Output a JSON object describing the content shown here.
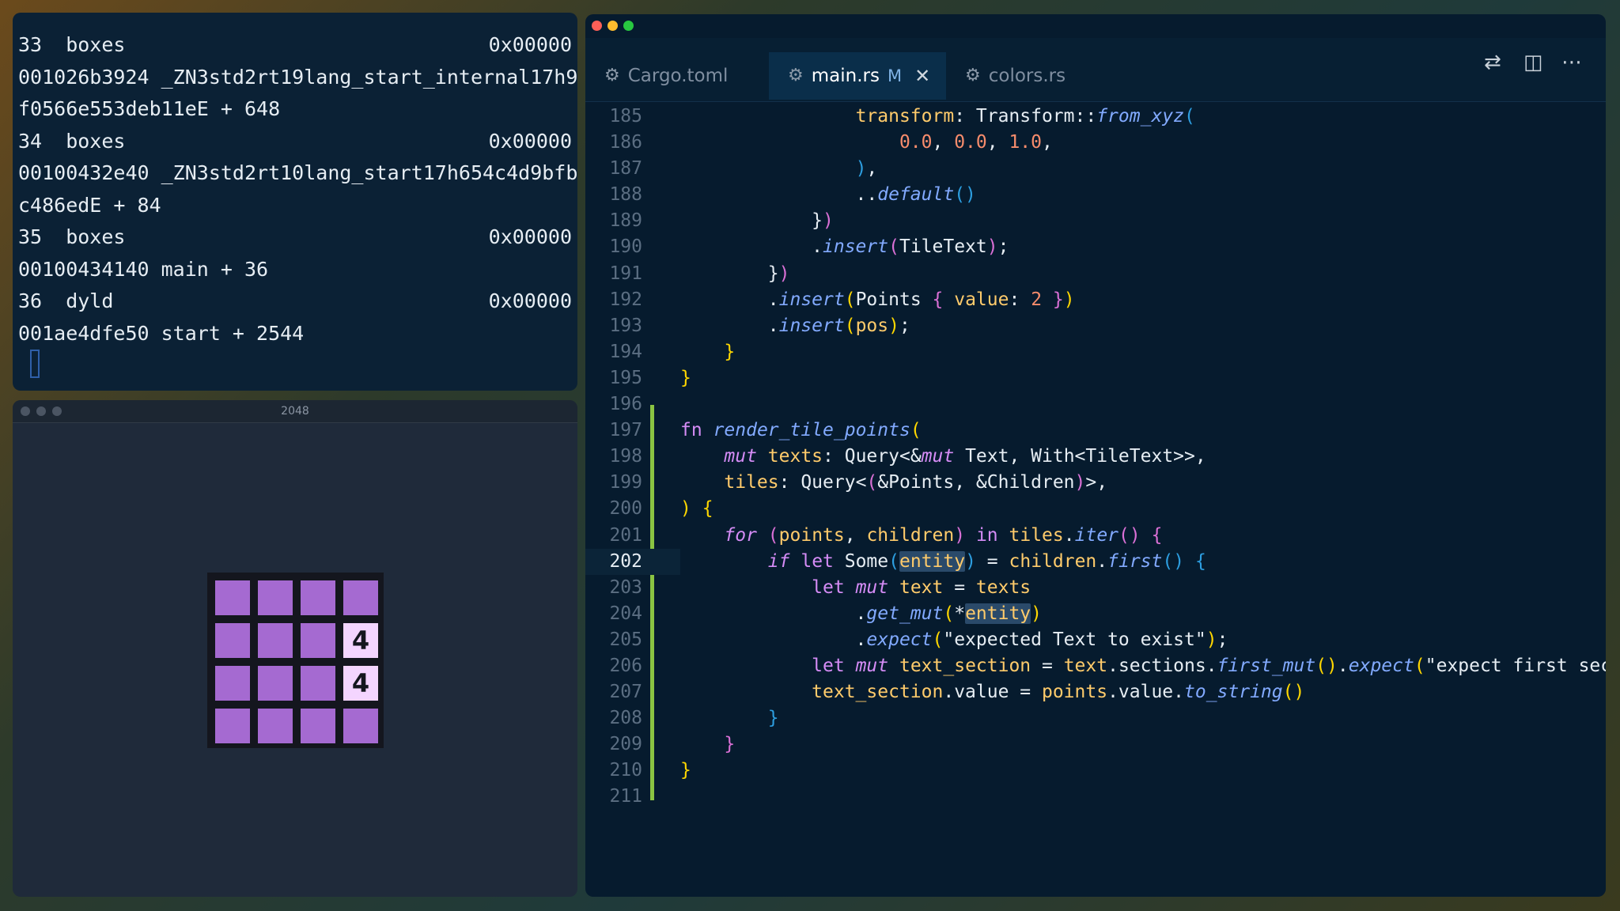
{
  "terminal": {
    "lines": [
      {
        "left": "33  boxes",
        "right": "0x00000"
      },
      {
        "left": "001026b3924 _ZN3std2rt19lang_start_internal17h9",
        "right": ""
      },
      {
        "left": "f0566e553deb11eE + 648",
        "right": ""
      },
      {
        "left": "34  boxes",
        "right": "0x00000"
      },
      {
        "left": "00100432e40 _ZN3std2rt10lang_start17h654c4d9bfb",
        "right": ""
      },
      {
        "left": "c486edE + 84",
        "right": ""
      },
      {
        "left": "35  boxes",
        "right": "0x00000"
      },
      {
        "left": "00100434140 main + 36",
        "right": ""
      },
      {
        "left": "36  dyld",
        "right": "0x00000"
      },
      {
        "left": "001ae4dfe50 start + 2544",
        "right": ""
      }
    ]
  },
  "game": {
    "window_title": "2048",
    "tile_color": "#a56ad1",
    "tile_highlight_color": "#f4d5ff",
    "grid": [
      [
        "",
        "",
        "",
        ""
      ],
      [
        "",
        "",
        "",
        "4"
      ],
      [
        "",
        "",
        "",
        "4"
      ],
      [
        "",
        "",
        "",
        ""
      ]
    ]
  },
  "editor": {
    "tabs": [
      {
        "label": "Cargo.toml",
        "icon": "gear-icon",
        "active": false,
        "modified": ""
      },
      {
        "label": "main.rs",
        "icon": "rust-icon",
        "active": true,
        "modified": "M"
      },
      {
        "label": "colors.rs",
        "icon": "rust-icon",
        "active": false,
        "modified": ""
      }
    ],
    "toolbar_icons": [
      "source-control-icon",
      "split-editor-icon",
      "more-actions-icon"
    ],
    "current_line": "202",
    "line_numbers": [
      "185",
      "186",
      "187",
      "188",
      "189",
      "190",
      "191",
      "192",
      "193",
      "194",
      "195",
      "196",
      "197",
      "198",
      "199",
      "200",
      "201",
      "202",
      "203",
      "204",
      "205",
      "206",
      "207",
      "208",
      "209",
      "210",
      "211"
    ]
  }
}
